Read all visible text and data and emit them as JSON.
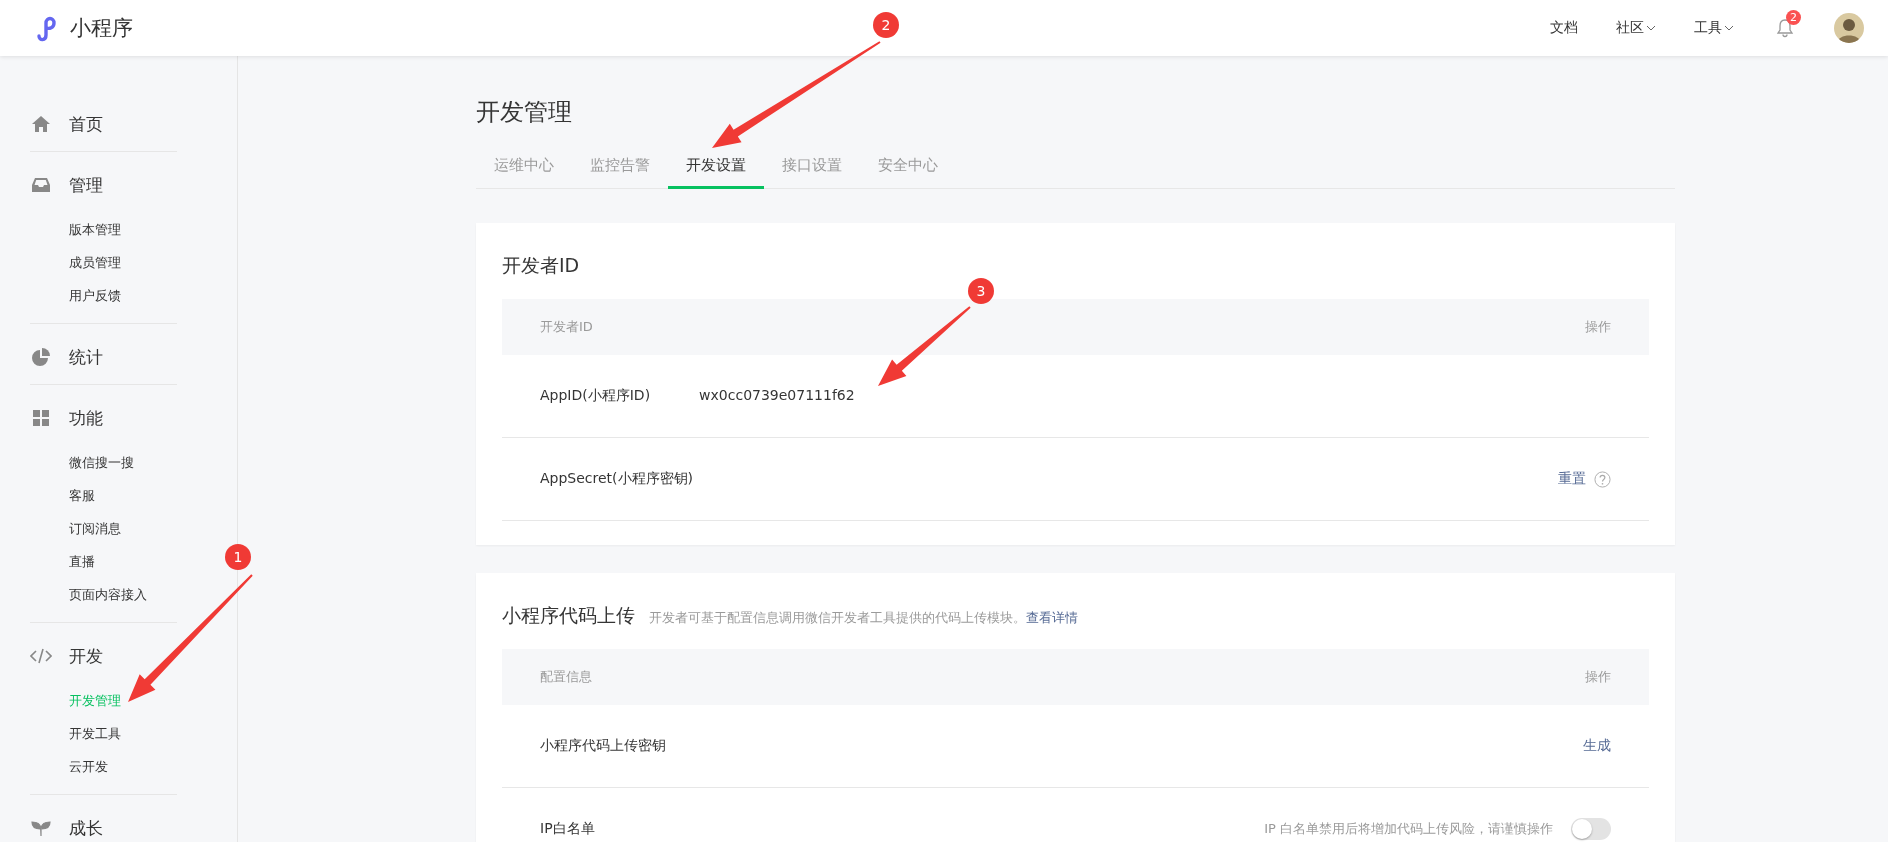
{
  "header": {
    "app_name": "小程序",
    "nav": [
      {
        "label": "文档",
        "dropdown": false
      },
      {
        "label": "社区",
        "dropdown": true
      },
      {
        "label": "工具",
        "dropdown": true
      }
    ],
    "notification_count": "2"
  },
  "sidebar": {
    "sections": [
      {
        "label": "首页"
      },
      {
        "label": "管理",
        "items": [
          {
            "label": "版本管理",
            "selected": false
          },
          {
            "label": "成员管理",
            "selected": false
          },
          {
            "label": "用户反馈",
            "selected": false
          }
        ]
      },
      {
        "label": "统计"
      },
      {
        "label": "功能",
        "items": [
          {
            "label": "微信搜一搜",
            "selected": false
          },
          {
            "label": "客服",
            "selected": false
          },
          {
            "label": "订阅消息",
            "selected": false
          },
          {
            "label": "直播",
            "selected": false
          },
          {
            "label": "页面内容接入",
            "selected": false
          }
        ]
      },
      {
        "label": "开发",
        "items": [
          {
            "label": "开发管理",
            "selected": true
          },
          {
            "label": "开发工具",
            "selected": false
          },
          {
            "label": "云开发",
            "selected": false
          }
        ]
      },
      {
        "label": "成长"
      }
    ]
  },
  "page_title": "开发管理",
  "tabs": [
    {
      "label": "运维中心",
      "selected": false
    },
    {
      "label": "监控告警",
      "selected": false
    },
    {
      "label": "开发设置",
      "selected": true
    },
    {
      "label": "接口设置",
      "selected": false
    },
    {
      "label": "安全中心",
      "selected": false
    }
  ],
  "cards": [
    {
      "title": "开发者ID",
      "columns": [
        "开发者ID",
        "操作"
      ],
      "rows": [
        {
          "label": "AppID(小程序ID)",
          "value": "wx0cc0739e07111f62"
        },
        {
          "label": "AppSecret(小程序密钥)",
          "action": "重置",
          "help": true
        }
      ]
    },
    {
      "title": "小程序代码上传",
      "description": "开发者可基于配置信息调用微信开发者工具提供的代码上传模块。",
      "link": "查看详情",
      "columns": [
        "配置信息",
        "操作"
      ],
      "rows": [
        {
          "label": "小程序代码上传密钥",
          "action": "生成"
        },
        {
          "label": "IP白名单",
          "note": "IP 白名单禁用后将增加代码上传风险，请谨慎操作",
          "toggle": {
            "on": false
          }
        }
      ]
    }
  ],
  "annotations": [
    {
      "number": "1"
    },
    {
      "number": "2"
    },
    {
      "number": "3"
    }
  ]
}
